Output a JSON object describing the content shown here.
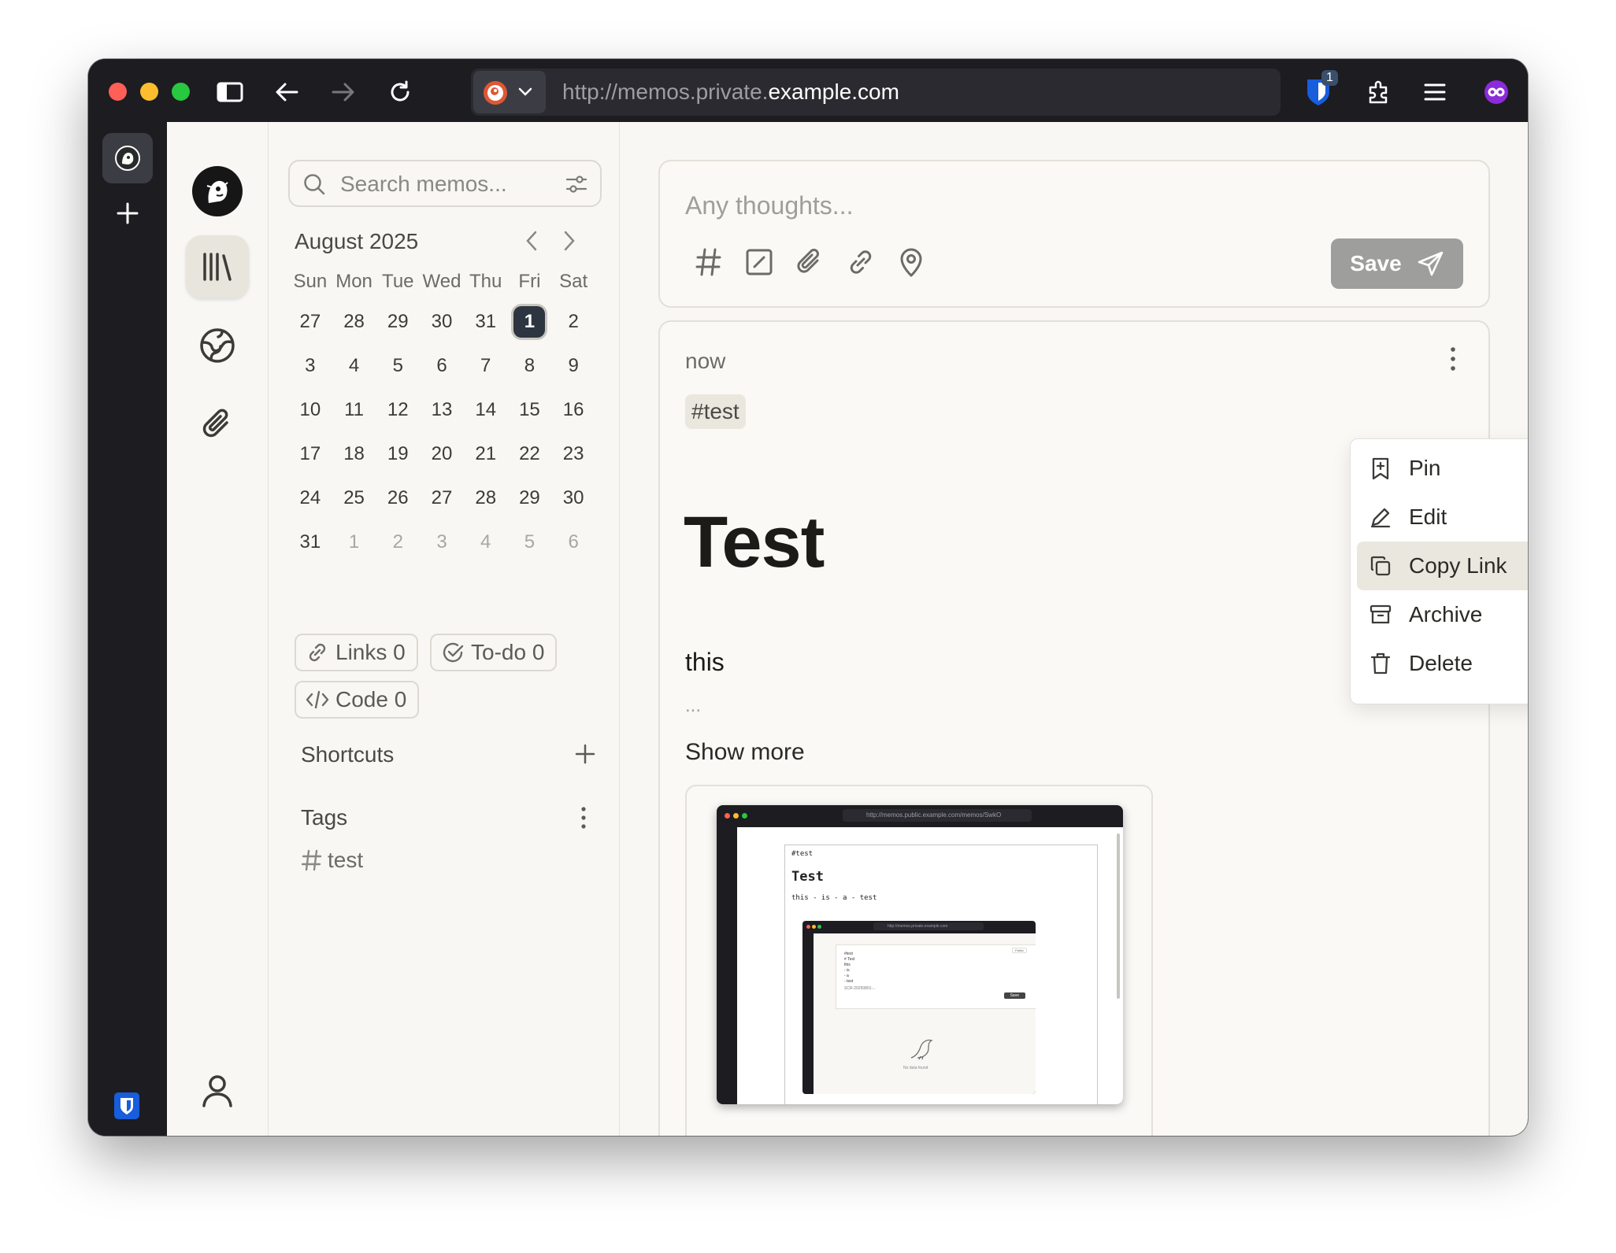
{
  "browser": {
    "url_prefix": "http://memos.private.",
    "url_domain": "example.com",
    "extension_badge": "1",
    "colors": {
      "chrome": "#1c1c21",
      "close": "#fe5f57",
      "minimize": "#febc2e",
      "maximize": "#28c840"
    }
  },
  "search": {
    "placeholder": "Search memos..."
  },
  "calendar": {
    "month": "August 2025",
    "weekdays": [
      "Sun",
      "Mon",
      "Tue",
      "Wed",
      "Thu",
      "Fri",
      "Sat"
    ],
    "days": [
      "27",
      "28",
      "29",
      "30",
      "31",
      "1",
      "2",
      "3",
      "4",
      "5",
      "6",
      "7",
      "8",
      "9",
      "10",
      "11",
      "12",
      "13",
      "14",
      "15",
      "16",
      "17",
      "18",
      "19",
      "20",
      "21",
      "22",
      "23",
      "24",
      "25",
      "26",
      "27",
      "28",
      "29",
      "30",
      "31",
      "1",
      "2",
      "3",
      "4",
      "5",
      "6"
    ],
    "selected": "1"
  },
  "stats": {
    "links": "Links 0",
    "todo": "To-do 0",
    "code": "Code 0"
  },
  "shortcuts": {
    "title": "Shortcuts"
  },
  "tags": {
    "title": "Tags",
    "items": [
      "test"
    ]
  },
  "editor": {
    "placeholder": "Any thoughts...",
    "save_label": "Save"
  },
  "memo": {
    "time": "now",
    "tag": "#test",
    "heading": "Test",
    "body": "this",
    "ellipsis": "...",
    "show_more": "Show more"
  },
  "menu": {
    "pin": "Pin",
    "edit": "Edit",
    "copy_link": "Copy Link",
    "archive": "Archive",
    "delete": "Delete"
  },
  "thumbnail": {
    "url": "http://memos.public.example.com/memos/SwkO",
    "tag": "#test",
    "heading": "Test",
    "body": "this - is - a - test",
    "nested_url": "http://memos.private.example.com",
    "nested_lines": [
      "#test",
      "# Test",
      "this",
      "- is",
      "- a",
      "- test"
    ],
    "nested_file": "SCR-20250801-...",
    "nested_save": "Save",
    "nested_public": "Public",
    "nested_empty": "No data found"
  }
}
